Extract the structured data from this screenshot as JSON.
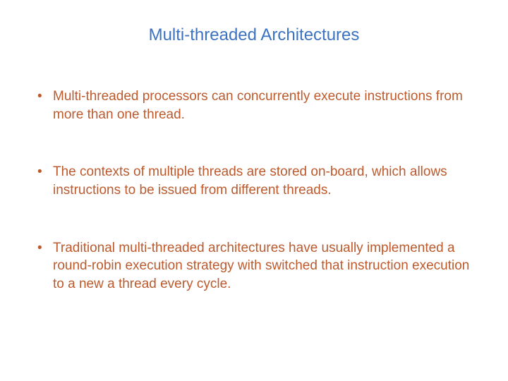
{
  "slide": {
    "title": "Multi-threaded Architectures",
    "bullets": [
      "Multi-threaded processors can concurrently execute instructions from more than one thread.",
      "The contexts of multiple threads are stored on-board, which allows instructions to be issued from different threads.",
      "Traditional multi-threaded architectures have usually implemented a round-robin execution strategy with switched that instruction execution to a new a thread every cycle."
    ]
  }
}
